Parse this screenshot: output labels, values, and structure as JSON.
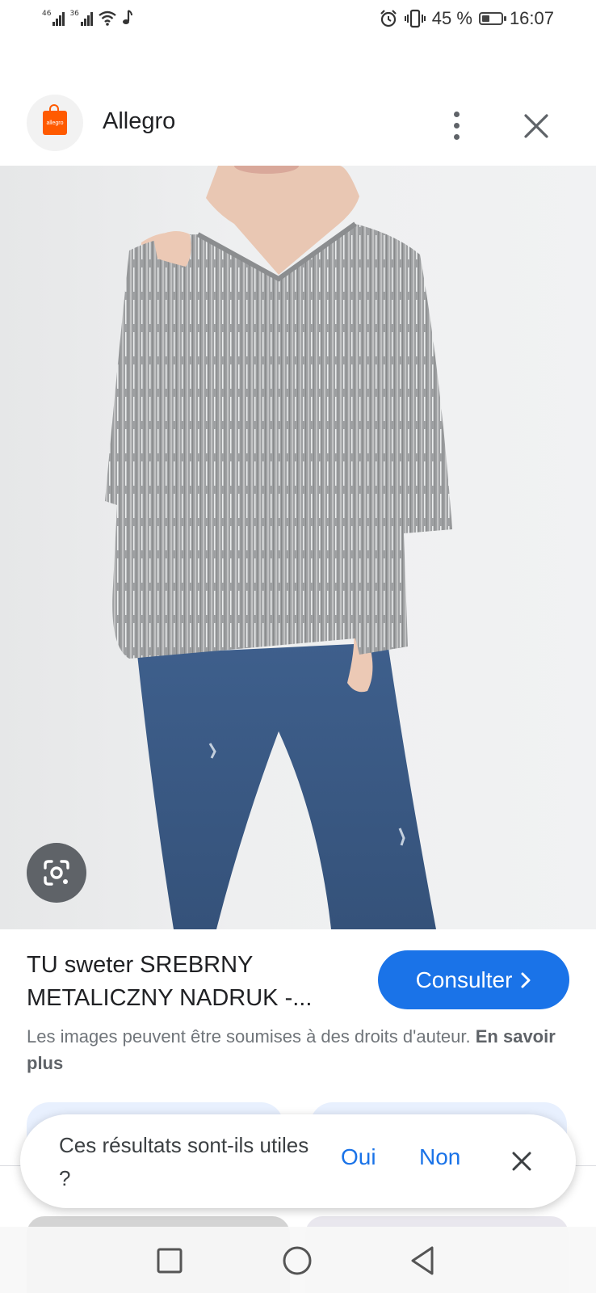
{
  "status_bar": {
    "signal_1_label": "46",
    "signal_2_label": "36",
    "battery_percent": "45 %",
    "battery_level": 0.45,
    "time": "16:07",
    "icons": [
      "signal-icon",
      "signal-icon",
      "wifi-icon",
      "music-note-icon",
      "alarm-icon",
      "vibrate-icon",
      "battery-icon"
    ]
  },
  "header": {
    "site_name": "Allegro",
    "logo_text": "allegro",
    "icons": [
      "allegro-logo-icon",
      "more-vert-icon",
      "close-icon"
    ]
  },
  "product": {
    "title": "TU sweter SREBRNY METALICZNY NADRUK -...",
    "visit_label": "Consulter",
    "copyright_text": "Les images peuvent être soumises à des droits d'auteur.",
    "learn_more": "En savoir plus"
  },
  "feedback": {
    "question": "Ces résultats sont-ils utiles ?",
    "yes": "Oui",
    "no": "Non"
  },
  "colors": {
    "accent": "#1a73e8",
    "brand": "#ff5a00",
    "lens_button": "#5f6368"
  }
}
